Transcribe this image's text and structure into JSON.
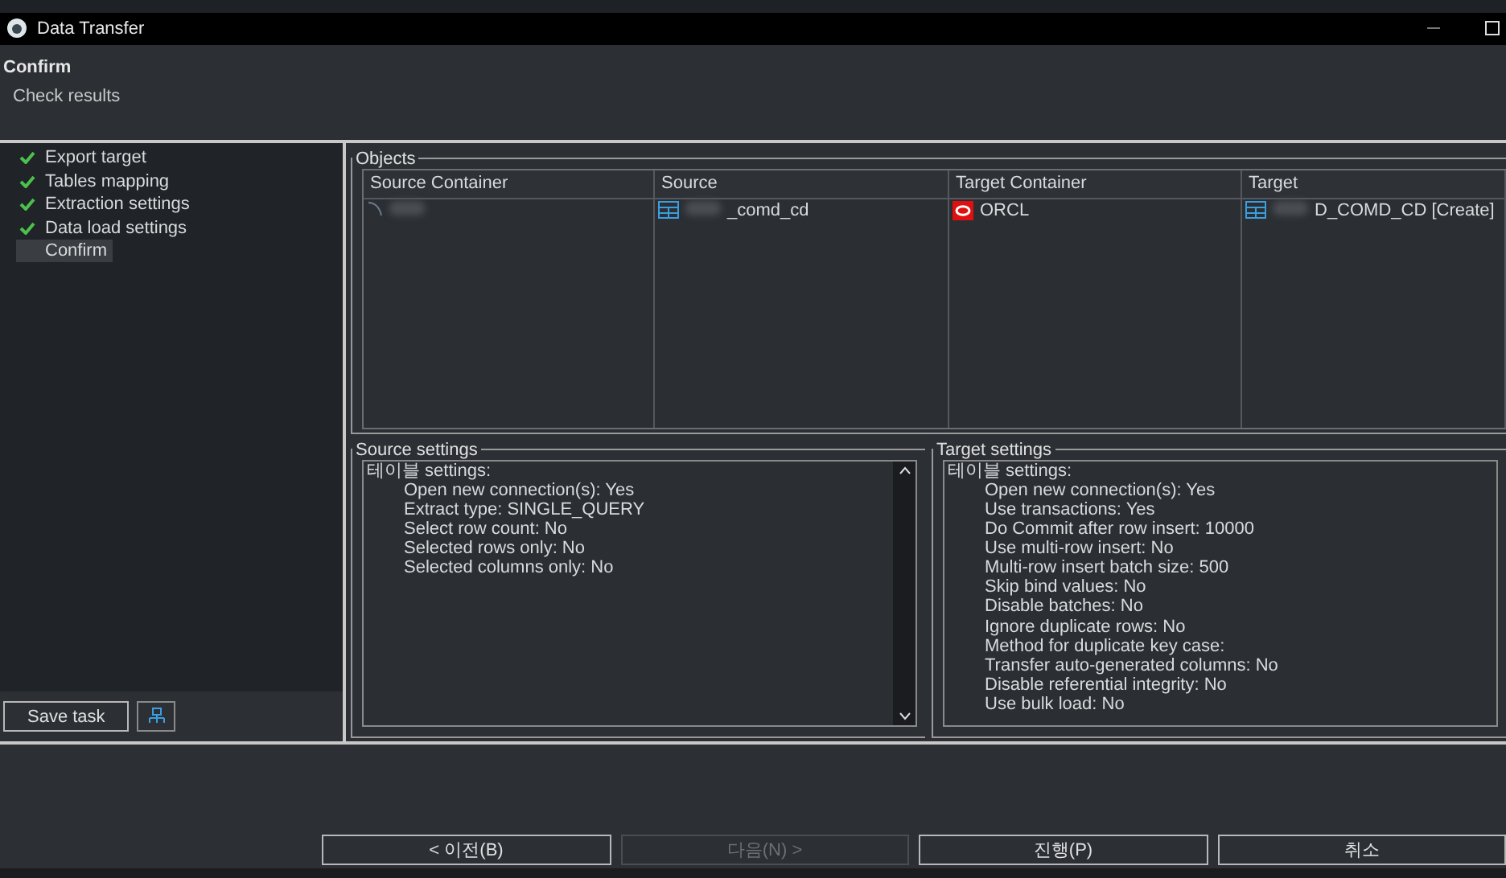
{
  "window": {
    "title": "Data Transfer"
  },
  "header": {
    "title": "Confirm",
    "subtitle": "Check results"
  },
  "steps": [
    {
      "label": "Export target",
      "checked": true,
      "selected": false
    },
    {
      "label": "Tables mapping",
      "checked": true,
      "selected": false
    },
    {
      "label": "Extraction settings",
      "checked": true,
      "selected": false
    },
    {
      "label": "Data load settings",
      "checked": true,
      "selected": false
    },
    {
      "label": "Confirm",
      "checked": false,
      "selected": true
    }
  ],
  "save_task": "Save task",
  "objects": {
    "title": "Objects",
    "columns": [
      "Source Container",
      "Source",
      "Target Container",
      "Target"
    ],
    "rows": [
      [
        {
          "kind": "connection",
          "text": ""
        },
        {
          "kind": "table",
          "text": "_comd_cd"
        },
        {
          "kind": "oracle",
          "text": "ORCL"
        },
        {
          "kind": "table",
          "text": "D_COMD_CD [Create]"
        }
      ]
    ]
  },
  "source_settings": {
    "title": "Source settings",
    "heading": "테이블 settings:",
    "lines": [
      "Open new connection(s): Yes",
      "Extract type: SINGLE_QUERY",
      "Select row count: No",
      "Selected rows only: No",
      "Selected columns only: No"
    ]
  },
  "target_settings": {
    "title": "Target settings",
    "heading": "테이블 settings:",
    "lines": [
      "Open new connection(s): Yes",
      "Use transactions: Yes",
      "Do Commit after row insert: 10000",
      "Use multi-row insert: No",
      "Multi-row insert batch size: 500",
      "Skip bind values: No",
      "Disable batches: No",
      "Ignore duplicate rows: No",
      "Method for duplicate key case:",
      "Transfer auto-generated columns: No",
      "Disable referential integrity: No",
      "Use bulk load: No"
    ]
  },
  "buttons": [
    {
      "label": "< 이전(B)",
      "disabled": false
    },
    {
      "label": "다음(N) >",
      "disabled": true
    },
    {
      "label": "진행(P)",
      "disabled": false
    },
    {
      "label": "취소",
      "disabled": false
    }
  ]
}
